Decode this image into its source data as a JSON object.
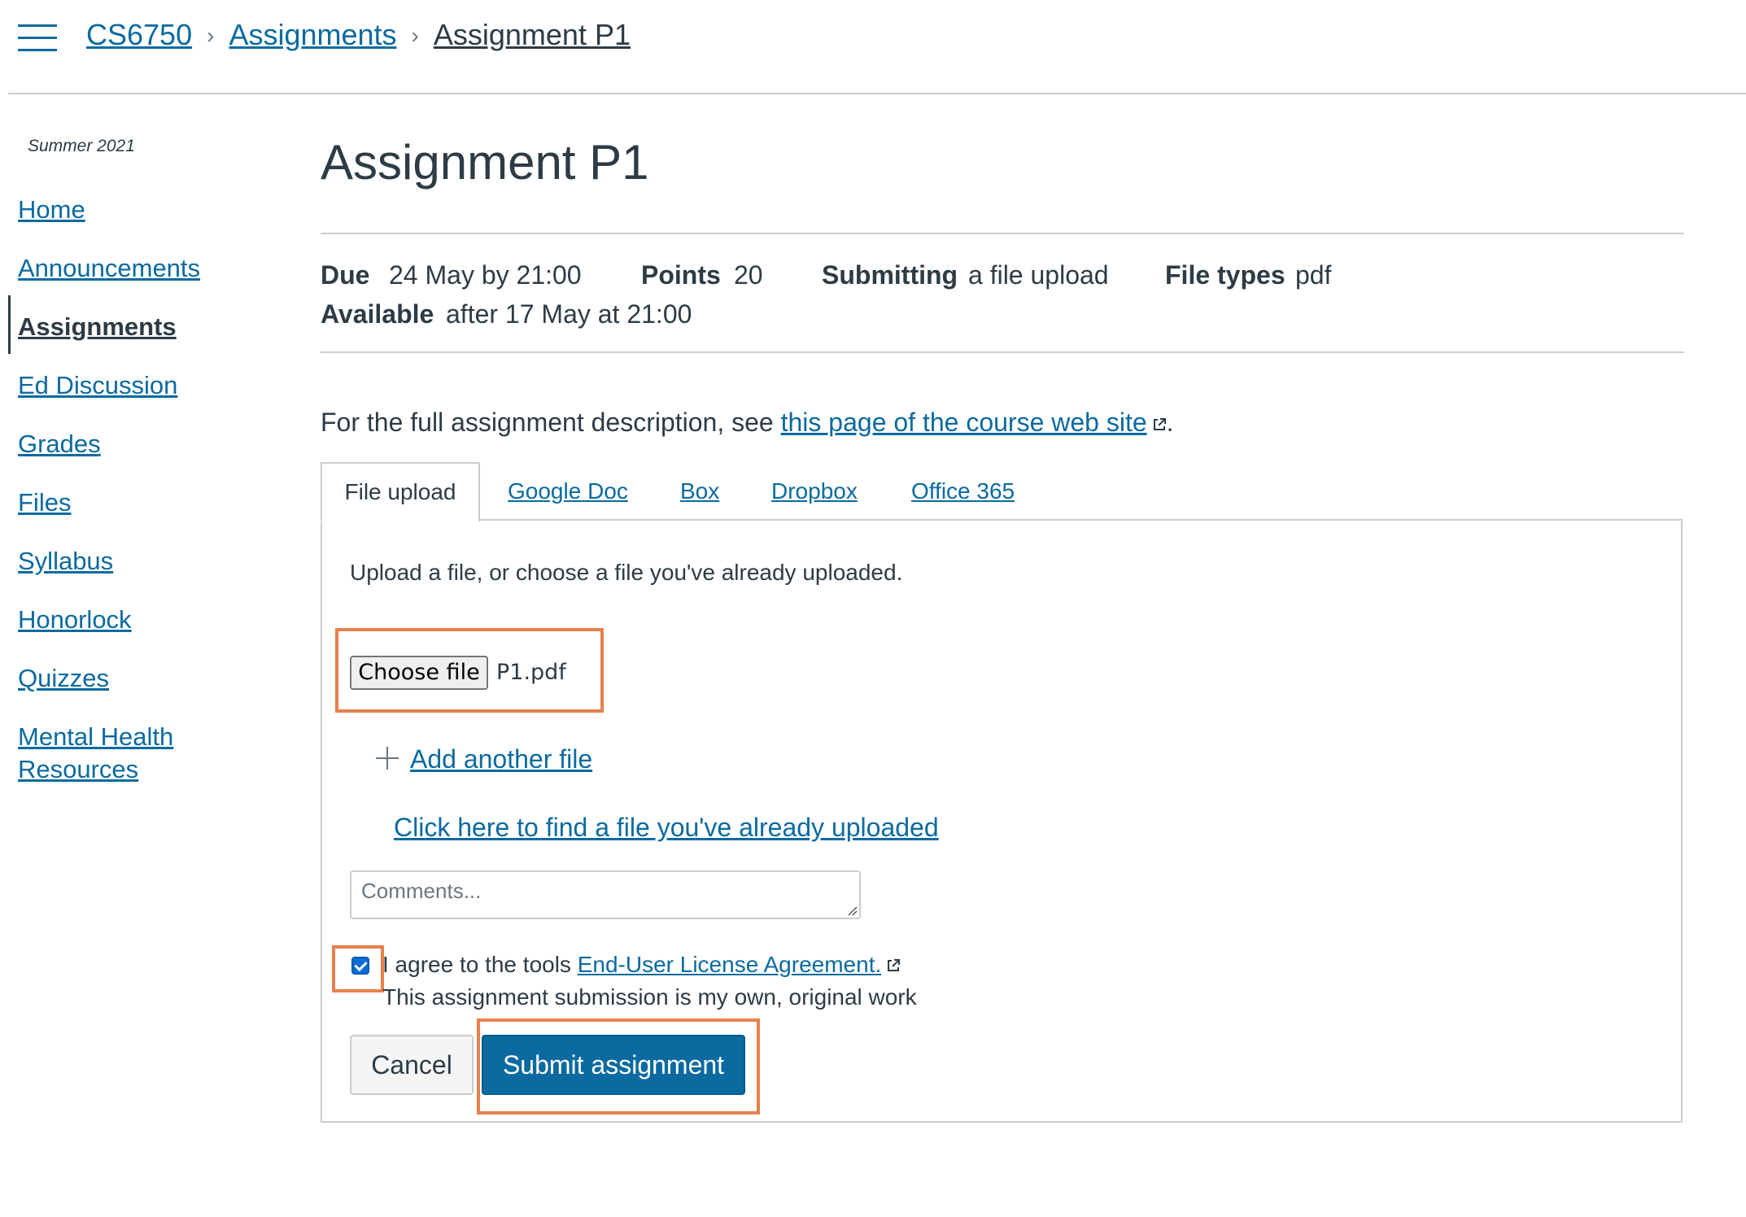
{
  "header": {
    "menu_icon": "hamburger-menu-icon",
    "breadcrumb": [
      "CS6750",
      "Assignments",
      "Assignment P1"
    ],
    "separator_icon": "chevron-right-icon"
  },
  "sidebar": {
    "term": "Summer 2021",
    "items": [
      {
        "label": "Home"
      },
      {
        "label": "Announcements"
      },
      {
        "label": "Assignments",
        "active": true
      },
      {
        "label": "Ed Discussion"
      },
      {
        "label": "Grades"
      },
      {
        "label": "Files"
      },
      {
        "label": "Syllabus"
      },
      {
        "label": "Honorlock"
      },
      {
        "label": "Quizzes"
      },
      {
        "label": "Mental Health",
        "label2": "Resources"
      }
    ]
  },
  "assignment": {
    "title": "Assignment P1",
    "due_label": "Due",
    "due_value": "24 May by 21:00",
    "points_label": "Points",
    "points_value": "20",
    "submitting_label": "Submitting",
    "submitting_value": "a file upload",
    "file_types_label": "File types",
    "file_types_value": "pdf",
    "available_label": "Available",
    "available_value": "after 17 May at 21:00",
    "description_prefix": "For the full assignment description, see ",
    "description_link": "this page of the course web site",
    "description_suffix": "."
  },
  "tabs": [
    "File upload",
    "Google Doc",
    "Box",
    "Dropbox",
    "Office 365"
  ],
  "upload": {
    "instructions": "Upload a file, or choose a file you've already uploaded.",
    "choose_file_label": "Choose file",
    "file_name": "P1.pdf",
    "add_another_label": "Add another file",
    "find_uploaded_label": "Click here to find a file you've already uploaded",
    "comments_placeholder": "Comments...",
    "comments_value": "",
    "agree_prefix": "I agree to the tools ",
    "agree_link": "End-User License Agreement.",
    "agree_checked": true,
    "original_work": "This assignment submission is my own, original work",
    "cancel_label": "Cancel",
    "submit_label": "Submit assignment"
  },
  "colors": {
    "link": "#0b6a9f",
    "text": "#2d3b45",
    "submit_bg": "#0b6a9f",
    "highlight": "#e8804c",
    "border": "#c7cdd1"
  }
}
